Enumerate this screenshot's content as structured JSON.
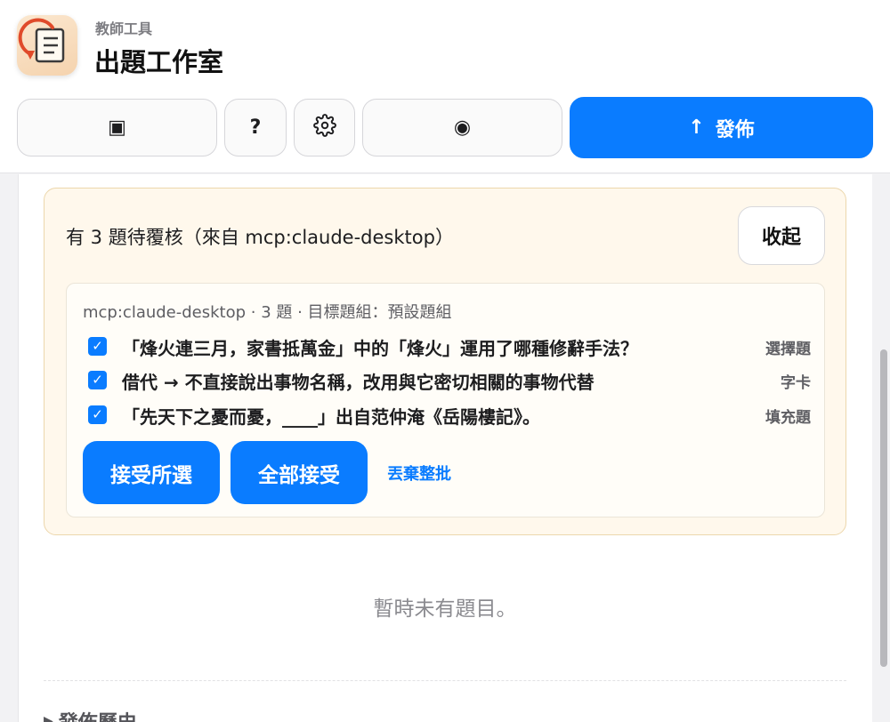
{
  "header": {
    "subtitle": "教師工具",
    "title": "出題工作室"
  },
  "toolbar": {
    "layout_icon_glyph": "▣",
    "help_label": "?",
    "record_icon_glyph": "◉",
    "publish_label": "發佈",
    "publish_arrow": "↑",
    "primary_color": "#0a7cff"
  },
  "review": {
    "title": "有 3 題待覆核（來自 mcp:claude-desktop）",
    "collapse_label": "收起",
    "batch_meta": "mcp:claude-desktop · 3 題 · 目標題組：預設題組",
    "items": [
      {
        "text": "「烽火連三月，家書抵萬金」中的「烽火」運用了哪種修辭手法？",
        "type": "選擇題",
        "checked": true
      },
      {
        "text": "借代 → 不直接說出事物名稱，改用與它密切相關的事物代替",
        "type": "字卡",
        "checked": true
      },
      {
        "text": "「先天下之憂而憂，____」出自范仲淹《岳陽樓記》。",
        "type": "填充題",
        "checked": true
      }
    ],
    "accept_selected_label": "接受所選",
    "accept_all_label": "全部接受",
    "discard_label": "丟棄整批"
  },
  "main": {
    "empty_message": "暫時未有題目。",
    "history_label": "發佈歷史"
  }
}
